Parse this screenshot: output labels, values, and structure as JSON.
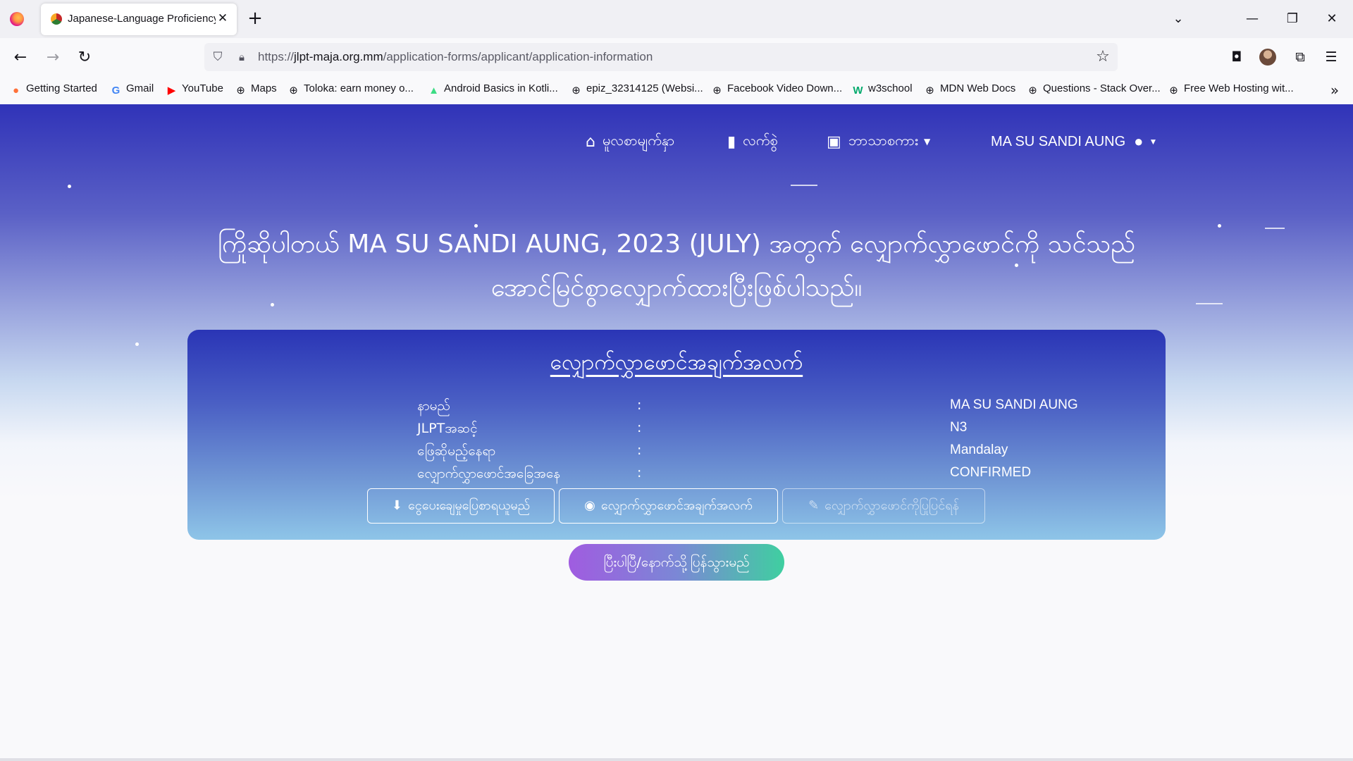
{
  "browser": {
    "tab": {
      "title": "Japanese-Language Proficiency",
      "close": "✕"
    },
    "new_tab": "+",
    "window": {
      "minimize": "—",
      "restore": "❐",
      "close": "✕"
    },
    "url": {
      "prefix": "https://",
      "host": "jlpt-maja.org.mm",
      "path": "/application-forms/applicant/application-information"
    },
    "nav": {
      "back": "←",
      "forward": "→",
      "reload": "↻"
    },
    "bookmarks": [
      {
        "label": "Getting Started",
        "icon": "firefox-icon"
      },
      {
        "label": "Gmail",
        "icon": "google-icon"
      },
      {
        "label": "YouTube",
        "icon": "youtube-icon"
      },
      {
        "label": "Maps",
        "icon": "globe-icon"
      },
      {
        "label": "Toloka: earn money o...",
        "icon": "globe-icon"
      },
      {
        "label": "Android Basics in Kotli...",
        "icon": "android-icon"
      },
      {
        "label": "epiz_32314125 (Websi...",
        "icon": "globe-icon"
      },
      {
        "label": "Facebook Video Down...",
        "icon": "globe-icon"
      },
      {
        "label": "w3school",
        "icon": "w3school-icon"
      },
      {
        "label": "MDN Web Docs",
        "icon": "globe-icon"
      },
      {
        "label": "Questions - Stack Over...",
        "icon": "globe-icon"
      },
      {
        "label": "Free Web Hosting wit...",
        "icon": "globe-icon"
      }
    ]
  },
  "site_nav": {
    "home": "မူလစာမျက်နှာ",
    "manual": "လက်စွဲ",
    "language": "ဘာသာစကား",
    "user": "MA SU SANDI AUNG"
  },
  "greeting": {
    "line1": "ကြိုဆိုပါတယ် MA SU SANDI AUNG, 2023 (JULY) အတွက် လျှောက်လွှာဖောင်ကို သင်သည်",
    "line2": "အောင်မြင်စွာလျှောက်ထားပြီးဖြစ်ပါသည်။"
  },
  "card": {
    "title": "လျှောက်လွှာဖောင်အချက်အလက်",
    "rows": [
      {
        "label": "နာမည်",
        "colon": ":",
        "value": "MA SU SANDI AUNG"
      },
      {
        "label": "JLPTအဆင့်",
        "colon": ":",
        "value": "N3"
      },
      {
        "label": "ဖြေဆိုမည့်နေရာ",
        "colon": ":",
        "value": "Mandalay"
      },
      {
        "label": "လျှောက်လွှာဖောင်အခြေအနေ",
        "colon": ":",
        "value": "CONFIRMED"
      }
    ],
    "buttons": {
      "download": "ငွေပေးချေမှုပြေစာရယူမည်",
      "view": "လျှောက်လွှာဖောင်အချက်အလက်",
      "edit": "လျှောက်လွှာဖောင်ကိုပြုပြင်ရန်"
    }
  },
  "back_button": "ပြီးပါပြီ/နောက်သို့ပြန်သွားမည်"
}
